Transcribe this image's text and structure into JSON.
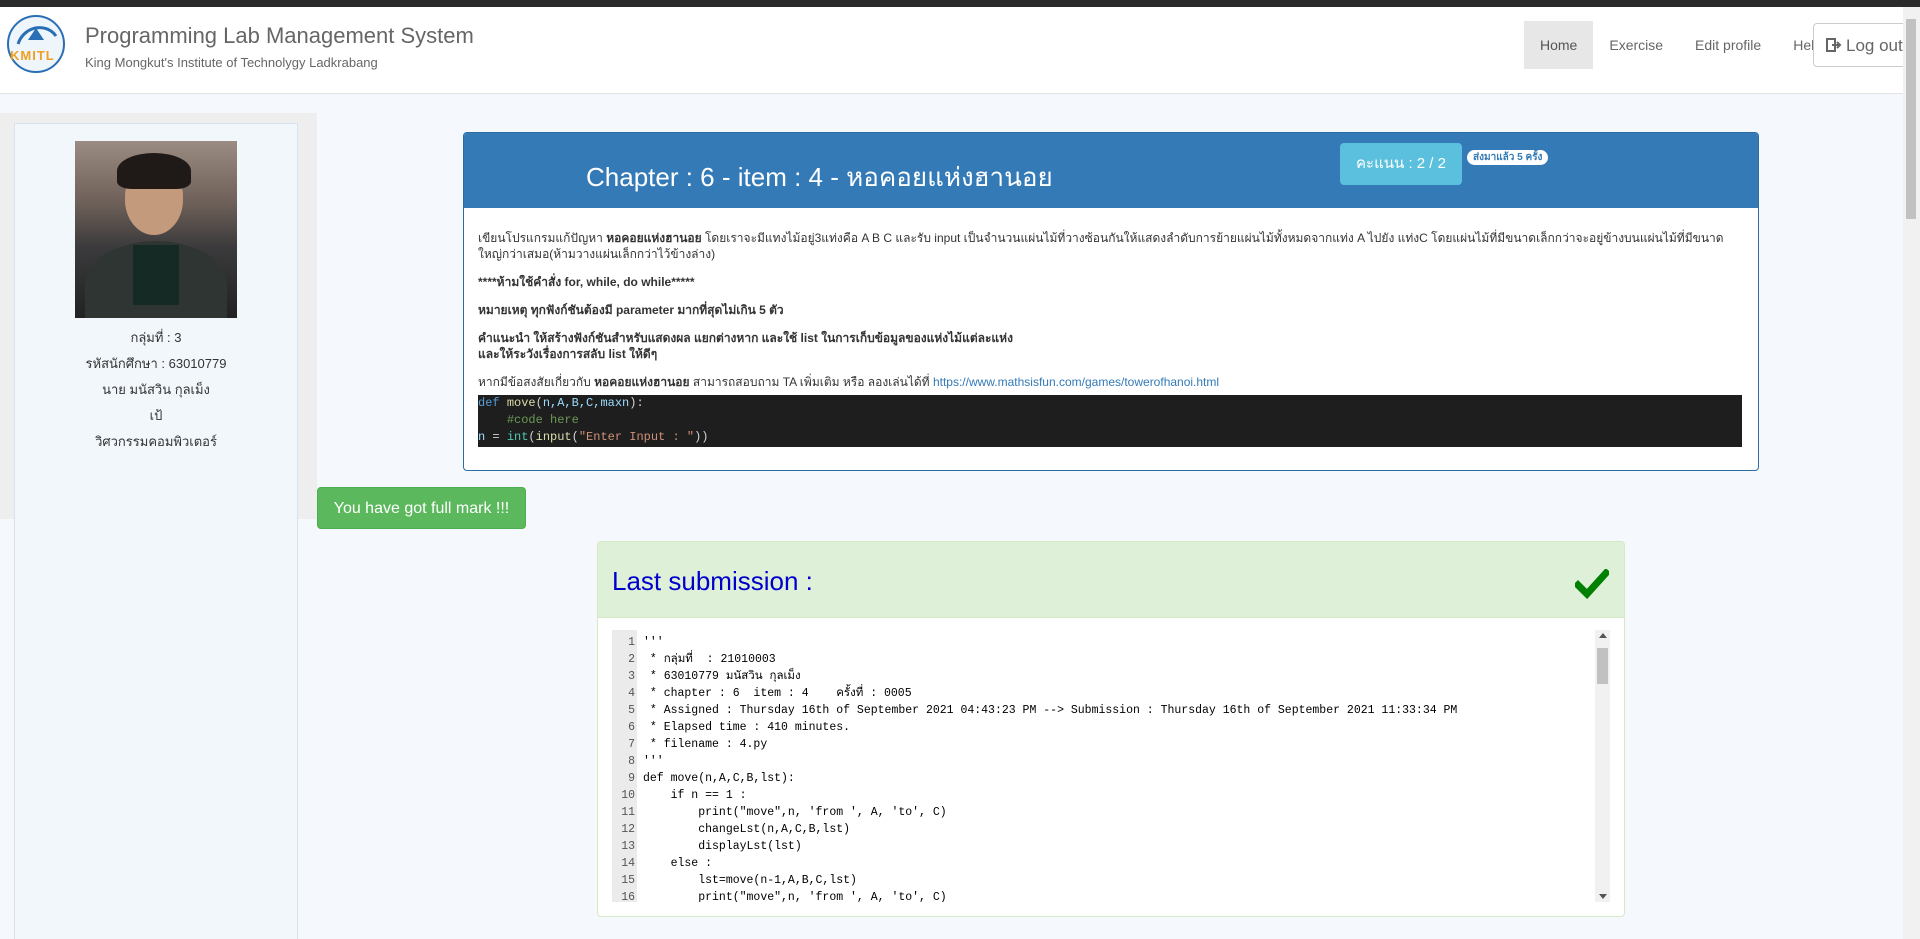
{
  "header": {
    "title": "Programming Lab Management System",
    "subtitle": "King Mongkut's Institute of Technolygy Ladkrabang",
    "logo_text": "KMITL",
    "nav": [
      {
        "label": "Home"
      },
      {
        "label": "Exercise"
      },
      {
        "label": "Edit profile"
      },
      {
        "label": "Help"
      }
    ],
    "logout_label": "Log out"
  },
  "sidebar": {
    "group": "กลุ่มที่ : 3",
    "student_id": "รหัสนักศึกษา : 63010779",
    "name": "นาย มนัสวิน กุลเม็ง",
    "nickname": "เป้",
    "department": "วิศวกรรมคอมพิวเตอร์"
  },
  "exercise": {
    "title": "Chapter : 6 - item : 4 - หอคอยแห่งฮานอย",
    "score": "คะแนน : 2 / 2",
    "sent_badge": "ส่งมาแล้ว 5 ครั้ง",
    "desc_1a": "เขียนโปรแกรมแก้ปัญหา",
    "desc_1b": "หอคอยแห่งฮานอย",
    "desc_1c": "โดยเราจะมีแทงไม้อยู่3แท่งคือ A B C และรับ input เป็นจำนวนแผ่นไม้ที่วางซ้อนกันให้แสดงลำดับการย้ายแผ่นไม้ทั้งหมดจากแท่ง A ไปยัง แท่งC โดยแผ่นไม้ที่มีขนาดเล็กกว่าจะอยู่ข้างบนแผ่นไม้ที่มีขนาดใหญ่กว่าเสมอ(ห้ามวางแผ่นเล็กกว่าไว้ข้างล่าง)",
    "rule": "****ห้ามใช้คำสั่ง for, while, do while*****",
    "note": "หมายเหตุ ทุกฟังก์ชันต้องมี parameter มากที่สุดไม่เกิน 5 ตัว",
    "hint_1": "คำแนะนำ ให้สร้างฟังก์ชันสำหรับแสดงผล แยกต่างหาก และใช้ list ในการเก็บข้อมูลของแห่งไม้แต่ละแห่ง",
    "hint_2": "และให้ระวังเรื่องการสลับ list ให้ดีๆ",
    "contact_a": "หากมีข้อสงสัยเกี่ยวกับ",
    "contact_b": "หอคอยแห่งฮานอย",
    "contact_c": "สามารถสอบถาม TA เพิ่มเติม หรือ ลองเล่นได้ที่",
    "link": "https://www.mathsisfun.com/games/towerofhanoi.html",
    "template": {
      "l1_def": "def",
      "l1_fn": "move",
      "l1_params": "n,A,B,C,maxn",
      "l2": "#code here",
      "l3_var": "n",
      "l3_int": "int",
      "l3_input": "input",
      "l3_str": "\"Enter Input : \""
    }
  },
  "status": {
    "full_mark": "You have got full mark !!!"
  },
  "submission": {
    "title": "Last submission :",
    "lines": [
      "'''",
      " * กลุ่มที่  : 21010003",
      " * 63010779 มนัสวิน กุลเม็ง",
      " * chapter : 6  item : 4    ครั้งที่ : 0005",
      " * Assigned : Thursday 16th of September 2021 04:43:23 PM --> Submission : Thursday 16th of September 2021 11:33:34 PM",
      " * Elapsed time : 410 minutes.",
      " * filename : 4.py",
      "'''",
      "def move(n,A,C,B,lst):",
      "    if n == 1 :",
      "        print(\"move\",n, 'from ', A, 'to', C)",
      "        changeLst(n,A,C,B,lst)",
      "        displayLst(lst)",
      "    else :",
      "        lst=move(n-1,A,B,C,lst)",
      "        print(\"move\",n, 'from ', A, 'to', C)"
    ]
  },
  "colors": {
    "primary": "#337ab7",
    "info": "#5bc0de",
    "success": "#5cb85c",
    "success_bg": "#dff0d8",
    "title_blue": "#0000cc",
    "check_green": "#008000"
  }
}
